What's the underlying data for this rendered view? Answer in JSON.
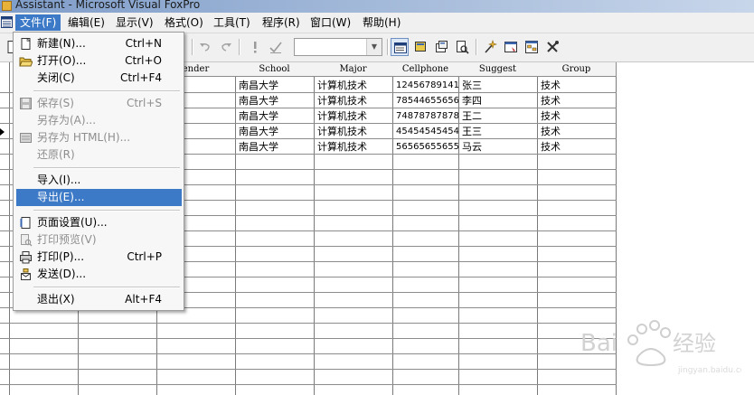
{
  "window": {
    "title": "Assistant - Microsoft Visual FoxPro"
  },
  "menubar": {
    "items": [
      {
        "label": "文件(F)",
        "active": true
      },
      {
        "label": "编辑(E)"
      },
      {
        "label": "显示(V)"
      },
      {
        "label": "格式(O)"
      },
      {
        "label": "工具(T)"
      },
      {
        "label": "程序(R)"
      },
      {
        "label": "窗口(W)"
      },
      {
        "label": "帮助(H)"
      }
    ]
  },
  "toolbar": {
    "combo_value": "",
    "icons": [
      "new-icon",
      "undo-icon",
      "redo-icon",
      "exclamation-icon",
      "check-modify-icon",
      "command-window-icon",
      "data-session-icon",
      "properties-icon",
      "report-preview-icon",
      "wizard-icon",
      "form-designer-icon",
      "database-designer-icon",
      "tools-icon"
    ]
  },
  "file_menu": {
    "items": [
      {
        "label": "新建(N)...",
        "shortcut": "Ctrl+N",
        "icon": "new-document-icon",
        "enabled": true
      },
      {
        "label": "打开(O)...",
        "shortcut": "Ctrl+O",
        "icon": "open-folder-icon",
        "enabled": true
      },
      {
        "label": "关闭(C)",
        "shortcut": "Ctrl+F4",
        "icon": "",
        "enabled": true
      },
      {
        "label": "保存(S)",
        "shortcut": "Ctrl+S",
        "icon": "save-disk-icon",
        "enabled": false
      },
      {
        "label": "另存为(A)...",
        "shortcut": "",
        "icon": "",
        "enabled": false
      },
      {
        "label": "另存为 HTML(H)...",
        "shortcut": "",
        "icon": "save-html-icon",
        "enabled": false
      },
      {
        "label": "还原(R)",
        "shortcut": "",
        "icon": "",
        "enabled": false
      },
      {
        "label": "导入(I)...",
        "shortcut": "",
        "icon": "",
        "enabled": true
      },
      {
        "label": "导出(E)...",
        "shortcut": "",
        "icon": "",
        "enabled": true,
        "highlighted": true
      },
      {
        "label": "页面设置(U)...",
        "shortcut": "",
        "icon": "page-setup-icon",
        "enabled": true
      },
      {
        "label": "打印预览(V)",
        "shortcut": "",
        "icon": "print-preview-icon",
        "enabled": false
      },
      {
        "label": "打印(P)...",
        "shortcut": "Ctrl+P",
        "icon": "printer-icon",
        "enabled": true
      },
      {
        "label": "发送(D)...",
        "shortcut": "",
        "icon": "send-mail-icon",
        "enabled": true
      },
      {
        "label": "退出(X)",
        "shortcut": "Alt+F4",
        "icon": "",
        "enabled": true
      }
    ]
  },
  "grid": {
    "columns": [
      "Gender",
      "School",
      "Major",
      "Cellphone",
      "Suggest",
      "Group"
    ],
    "visible_header_fragment": "ender",
    "rows": [
      {
        "school": "南昌大学",
        "major": "计算机技术",
        "cellphone": "12456789141",
        "suggest": "张三",
        "group": "技术"
      },
      {
        "school": "南昌大学",
        "major": "计算机技术",
        "cellphone": "78544655656",
        "suggest": "李四",
        "group": "技术"
      },
      {
        "school": "南昌大学",
        "major": "计算机技术",
        "cellphone": "74878787878",
        "suggest": "王二",
        "group": "技术"
      },
      {
        "school": "南昌大学",
        "major": "计算机技术",
        "cellphone": "45454545454",
        "suggest": "王三",
        "group": "技术"
      },
      {
        "school": "南昌大学",
        "major": "计算机技术",
        "cellphone": "56565655655",
        "suggest": "马云",
        "group": "技术"
      }
    ]
  },
  "watermark": {
    "text": "Baidu经验",
    "color": "#cccccc"
  },
  "colors": {
    "menu_highlight": "#3c79c6",
    "title_bar": "#7f9dc9"
  }
}
